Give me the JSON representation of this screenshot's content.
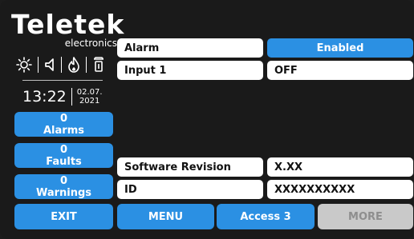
{
  "brand": {
    "name": "Teletek",
    "subtitle": "electronics"
  },
  "status": {
    "icons": [
      "sun-icon",
      "speaker-icon",
      "fire-icon",
      "tamper-icon"
    ],
    "time": "13:22",
    "date_line1": "02.07.",
    "date_line2": "2021"
  },
  "counters": {
    "alarms_count": "0",
    "alarms_label": "Alarms",
    "faults_count": "0",
    "faults_label": "Faults",
    "warnings_count": "0",
    "warnings_label": "Warnings"
  },
  "rows": {
    "alarm_label": "Alarm",
    "alarm_value": "Enabled",
    "input_label": "Input 1",
    "input_value": "OFF",
    "software_label": "Software Revision",
    "software_value": "X.XX",
    "id_label": "ID",
    "id_value": "XXXXXXXXXX"
  },
  "footer": {
    "exit": "EXIT",
    "menu": "MENU",
    "access": "Access 3",
    "more": "MORE"
  },
  "colors": {
    "accent": "#2b90e3",
    "background": "#1a1a1a",
    "disabled": "#c9c9c9"
  }
}
